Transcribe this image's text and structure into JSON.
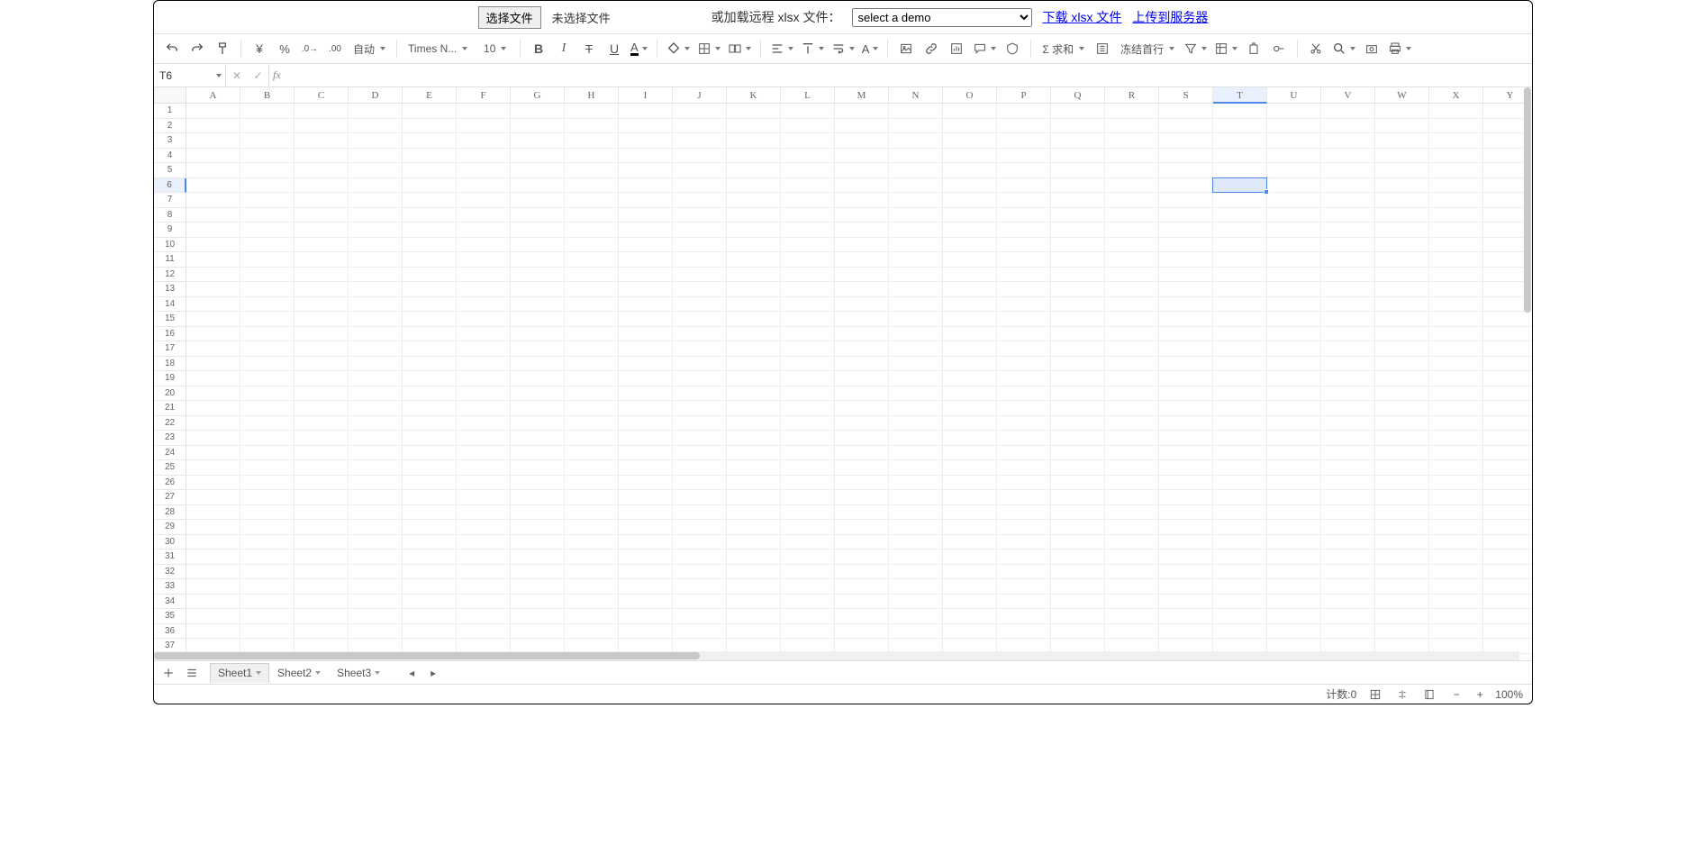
{
  "topbar": {
    "choose_file": "选择文件",
    "no_file": "未选择文件",
    "remote_label": "或加载远程 xlsx 文件：",
    "demo_placeholder": "select a demo",
    "download_link": "下载 xlsx 文件",
    "upload_link": "上传到服务器"
  },
  "toolbar": {
    "format_auto": "自动",
    "font_name": "Times N...",
    "font_size": "10",
    "sum_label": "Σ 求和",
    "freeze_label": "冻结首行"
  },
  "fxbar": {
    "cell_ref": "T6",
    "fx_label": "fx",
    "formula_value": ""
  },
  "columns": [
    "A",
    "B",
    "C",
    "D",
    "E",
    "F",
    "G",
    "H",
    "I",
    "J",
    "K",
    "L",
    "M",
    "N",
    "O",
    "P",
    "Q",
    "R",
    "S",
    "T",
    "U",
    "V",
    "W",
    "X",
    "Y"
  ],
  "selected_col": "T",
  "selected_row": 6,
  "row_count": 38,
  "sheets": {
    "tabs": [
      "Sheet1",
      "Sheet2",
      "Sheet3"
    ],
    "active": 0
  },
  "status": {
    "count_label": "计数:0",
    "zoom": "100%"
  }
}
